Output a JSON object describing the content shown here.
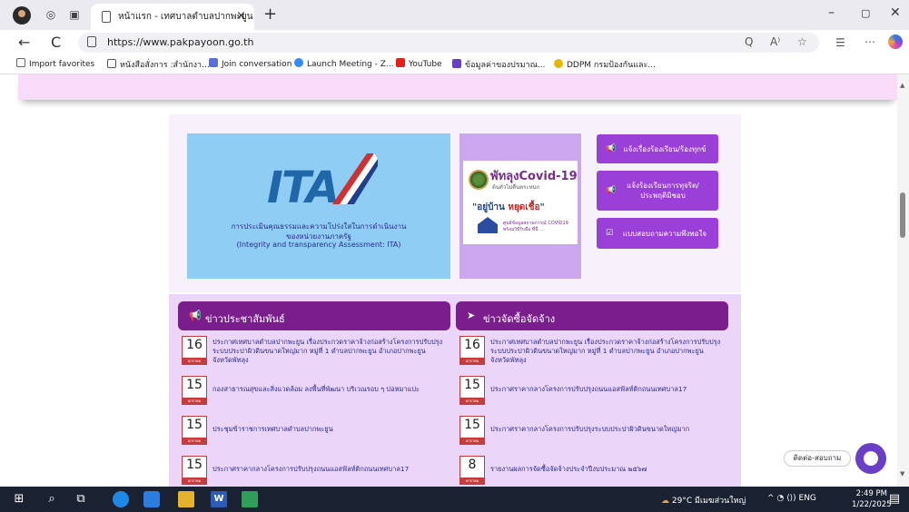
{
  "browser": {
    "tab_title": "หน้าแรก - เทศบาลตำบลปากพะยูน",
    "tab_close": "×",
    "new_tab": "+",
    "url": "https://www.pakpayoon.go.th",
    "nav_back": "←",
    "nav_refresh": "C",
    "win_min": "–",
    "win_restore": "▢",
    "win_close": "✕",
    "omni_icons": [
      "Q",
      "A⁾",
      "☆",
      "☰",
      "⋯"
    ]
  },
  "bookmarks": [
    {
      "label": "Import favorites",
      "color": "#666"
    },
    {
      "label": "หนังสือสั่งการ :สำนักงา...",
      "color": "#555"
    },
    {
      "label": "Join conversation",
      "color": "#5a6fd8"
    },
    {
      "label": "Launch Meeting - Z...",
      "color": "#2d8cff"
    },
    {
      "label": "YouTube",
      "color": "#e62117"
    },
    {
      "label": "ข้อมูลค่าของปรมาณ...",
      "color": "#6a3fc8"
    },
    {
      "label": "DDPM กรมป้องกันและ...",
      "color": "#e6b800"
    }
  ],
  "ita": {
    "logo_text": "ITA",
    "line1": "การประเมินคุณธรรมและความโปร่งใสในการดำเนินงาน",
    "line2": "ของหน่วยงานภาครัฐ",
    "line3": "(Integrity and transparency Assessment: ITA)"
  },
  "covid": {
    "title": "พัทลุงCovid-19",
    "subtitle": "ต้นตัวไม่ตื่นตระหนก",
    "slogan_prefix": "\"อยู่บ้าน ",
    "slogan_red": "หยุดเชื้อ",
    "slogan_suffix": "\"",
    "note_line1": "ศูนย์ข้อมูลสถานการณ์ COVID19",
    "note_line2": "พร้อมวิธีรับมือ ที่นี่ ..."
  },
  "action_buttons": [
    {
      "icon": "📢",
      "label": "แจ้งเรื่องร้องเรียน/ร้องทุกข์"
    },
    {
      "icon": "📢",
      "label": "แจ้งร้องเรียนการทุจริต/ประพฤติมิชอบ"
    },
    {
      "icon": "☑",
      "label": "แบบสอบถามความพึงพอใจ"
    }
  ],
  "news_pr": {
    "heading": "ข่าวประชาสัมพันธ์",
    "items": [
      {
        "day": "16",
        "month": "มกราคม",
        "text": "ประกาศเทศบาลตำบลปากพะยูน เรื่องประกวดราคาจ้างก่อสร้างโครงการปรับปรุงระบบประปาผิวดินขนาดใหญ่มาก หมู่ที่ 1 ตำบลปากพะยูน อำเภอปากพะยูน จังหวัดพัทลุง"
      },
      {
        "day": "15",
        "month": "มกราคม",
        "text": "กองสาธารณสุขและสิ่งแวดล้อม ลงพื้นที่พัฒนา บริเวณรอบ ๆ บ่อหมาแปะ"
      },
      {
        "day": "15",
        "month": "มกราคม",
        "text": "ประชุมข้าราชการเทศบาลตำบลปากพะยูน"
      },
      {
        "day": "15",
        "month": "มกราคม",
        "text": "ประกาศราคากลางโครงการปรับปรุงถนนแอสฟัลท์ติกถนนเทศบาล17"
      }
    ]
  },
  "news_procure": {
    "heading": "ข่าวจัดซื้อจัดจ้าง",
    "items": [
      {
        "day": "16",
        "month": "มกราคม",
        "text": "ประกาศเทศบาลตำบลปากพะยูน เรื่องประกวดราคาจ้างก่อสร้างโครงการปรับปรุงระบบประปาผิวดินขนาดใหญ่มาก หมู่ที่ 1 ตำบลปากพะยูน อำเภอปากพะยูน จังหวัดพัทลุง"
      },
      {
        "day": "15",
        "month": "มกราคม",
        "text": "ประกาศราคากลางโครงการปรับปรุงถนนแอสฟัลท์ติกถนนเทศบาล17"
      },
      {
        "day": "15",
        "month": "มกราคม",
        "text": "ประกาศราคากลางโครงการปรับปรุงระบบประปาผิวดินขนาดใหญ่มาก"
      },
      {
        "day": "8",
        "month": "มกราคม",
        "text": "รายงานผลการจัดซื้อจัดจ้างประจำปีงบประมาณ ๒๕๖๗"
      }
    ]
  },
  "contact_label": "ติดต่อ-สอบถาม",
  "taskbar": {
    "weather": "29°C มีเมฆส่วนใหญ่",
    "tray_icons": "^ ◔ ⟨⟩) ENG",
    "time": "2:49 PM",
    "date": "1/22/2025"
  }
}
